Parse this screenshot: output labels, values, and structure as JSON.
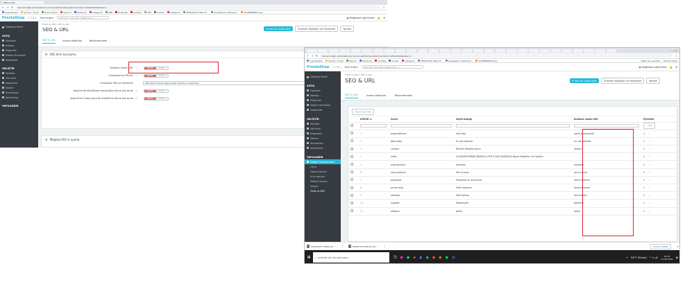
{
  "browser_top": {
    "address": "Güvenli değil | atmodadcorp.com/yonetim/index.php?controller=AdminMeta&token=...",
    "bookmarks": [
      "Uygulamalar",
      "Yardımcı Ücret",
      "Ünsel Yazılım",
      "tasarım",
      "Facebook",
      "Instagram",
      "GBK",
      "Pinterest",
      "YouTube",
      "GIFs",
      "hordes",
      "instagram",
      "TEMUSTAIC TRAC Pr...",
      "Karşılaşma mahkeme...",
      "SAHIBİNDEN blog..."
    ],
    "profile_label": "Mağazamı görüntüle"
  },
  "left": {
    "logo": "PrestaShop",
    "version": "1.7.6.x",
    "quick_access": "Hızlı erişim",
    "search_placeholder": "Ara (örn. ürün adı, müşteri adı...)",
    "breadcrumb": "Trafik ve SEO / SEO & URL",
    "page_title": "SEO & URL",
    "tabs": [
      "SEO & URL",
      "Arama Motorları",
      "Yönlendirmeler"
    ],
    "btn_add": "Yeni bir sayfa ekle",
    "btn_modules": "Önerilen Modüller ve Hizmetler",
    "btn_help": "Yardım",
    "sidebar": {
      "dashboard": "Gösterge Paneli",
      "sales_title": "SATIŞ",
      "sales": [
        "Siparişler",
        "Katalog",
        "Müşteriler",
        "Müşteri Hizmetleri",
        "İstatistikler"
      ],
      "improve_title": "GELİŞTİR",
      "improve": [
        "Modüller",
        "Görünüm",
        "Kargolama",
        "Ödeme",
        "Uluslararası",
        "Advertising"
      ],
      "configure_title": "YAPILANDIR"
    },
    "panel1_title": "URL'lerin kurulumu",
    "fields": [
      {
        "label": "Kullanıcı dostu URL",
        "off": "HAYIR",
        "on": "EVET"
      },
      {
        "label": "Vurgulanmış URL'ler",
        "off": "HAYIR",
        "on": "EVET"
      },
      {
        "label": "Canonical URL'ye yönlendir",
        "value": "302 Geçici Olarak Taşındı (eski davranış, önerilmez)"
      },
      {
        "label": "Apache'de MultiViews seçeneğini devre dışı bırak",
        "off": "HAYIR",
        "on": "EVET"
      },
      {
        "label": "Apache'nin mod_security modülünü devre dışı bırak",
        "off": "HAYIR",
        "on": "EVET"
      }
    ],
    "panel2_title": "Mağaza URL'si ayarla"
  },
  "right": {
    "address": "Güvenli değil | atmodadcorp.com/yonetim/index.php?controller=AdminMeta&token=...",
    "other_bookmarks": "Diğer yer işaretleri",
    "reading_list": "Okuma listesi",
    "logo": "PrestaShop",
    "version": "1.7.6.x",
    "quick_access": "Hızlı erişim",
    "search_placeholder": "Ara (örn. ürün adı, müşteri adı...)",
    "profile_label": "Mağazamı görüntüle",
    "breadcrumb": "Trafik ve SEO / SEO & URL",
    "page_title": "SEO & URL",
    "tabs": [
      "SEO & URL",
      "Arama Motorları",
      "Yönlendirmeler"
    ],
    "btn_add": "Yeni bir sayfa ekle",
    "btn_modules": "Önerilen Modüller ve Hizmetler",
    "btn_help": "Yardım",
    "bulk_actions": "Toplu İşlemler",
    "sidebar": {
      "dashboard": "Gösterge Paneli",
      "sales_title": "SATIŞ",
      "sales": [
        "Siparişler",
        "Katalog",
        "Müşteriler",
        "Müşteri Hizmetleri",
        "İstatistikler"
      ],
      "improve_title": "GELİŞTİR",
      "improve": [
        "Modüller",
        "Görünüm",
        "Kargolama",
        "Ödeme",
        "Uluslararası",
        "Advertising"
      ],
      "configure_title": "YAPILANDIR",
      "store_params": "Mağaza Parametreleri",
      "sub": [
        "Genel",
        "Sipariş Ayarları",
        "Ürün Ayarları",
        "Müşteri Ayarları",
        "İletişim",
        "Trafik ve SEO"
      ]
    },
    "columns": [
      "KİMLİK",
      "Sayfa",
      "Sayfa başlığı",
      "Kullanıcı dostu URL",
      "Eylemler"
    ],
    "search_btn": "Ara",
    "rows": [
      {
        "id": "1",
        "page": "pagenotfound",
        "title": "404 hata",
        "url": "sayfa-bulunamadi"
      },
      {
        "id": "2",
        "page": "best-sales",
        "title": "En çok satanlar",
        "url": "en-cok-satanlar"
      },
      {
        "id": "3",
        "page": "contact",
        "title": "Bizimle iletişime geçin",
        "url": "iletisim"
      },
      {
        "id": "4",
        "page": "index",
        "title": "ÇUHADAR MENŞE AKARSU & POLO DAŞ MAĞAZASI Bayan Modelleri ve Fiyatları",
        "url": ""
      },
      {
        "id": "5",
        "page": "manufacturer",
        "title": "Markalar",
        "url": "markalar"
      },
      {
        "id": "6",
        "page": "new-products",
        "title": "Yeni ürünler",
        "url": "yeni-urunler"
      },
      {
        "id": "7",
        "page": "password",
        "title": "Parolanızı mı unuttunuz",
        "url": "sifre-kurtarma"
      },
      {
        "id": "8",
        "page": "prices-drop",
        "title": "Fiyatı düşenler",
        "url": "fiyati-dusenler"
      },
      {
        "id": "9",
        "page": "sitemap",
        "title": "Site haritası",
        "url": "site-haritasi"
      },
      {
        "id": "10",
        "page": "supplier",
        "title": "Tedarikçiler",
        "url": "tedarikci"
      },
      {
        "id": "11",
        "page": "address",
        "title": "Adres",
        "url": "adres"
      }
    ],
    "downloads": [
      "MASAUSTU-VIDEO.zip",
      "PRODUCT-DATA-01.zip"
    ],
    "show_all": "Tümünü göster",
    "taskbar_search": "Aramak için buraya yazın",
    "weather": "24°C Güneşli",
    "clock_time": "14:15",
    "clock_date": "27.09.2021"
  },
  "colors": {
    "accent": "#25b9d7",
    "switch_off": "#e56a6a",
    "highlight": "#e21f26",
    "sidebar": "#363a41"
  }
}
